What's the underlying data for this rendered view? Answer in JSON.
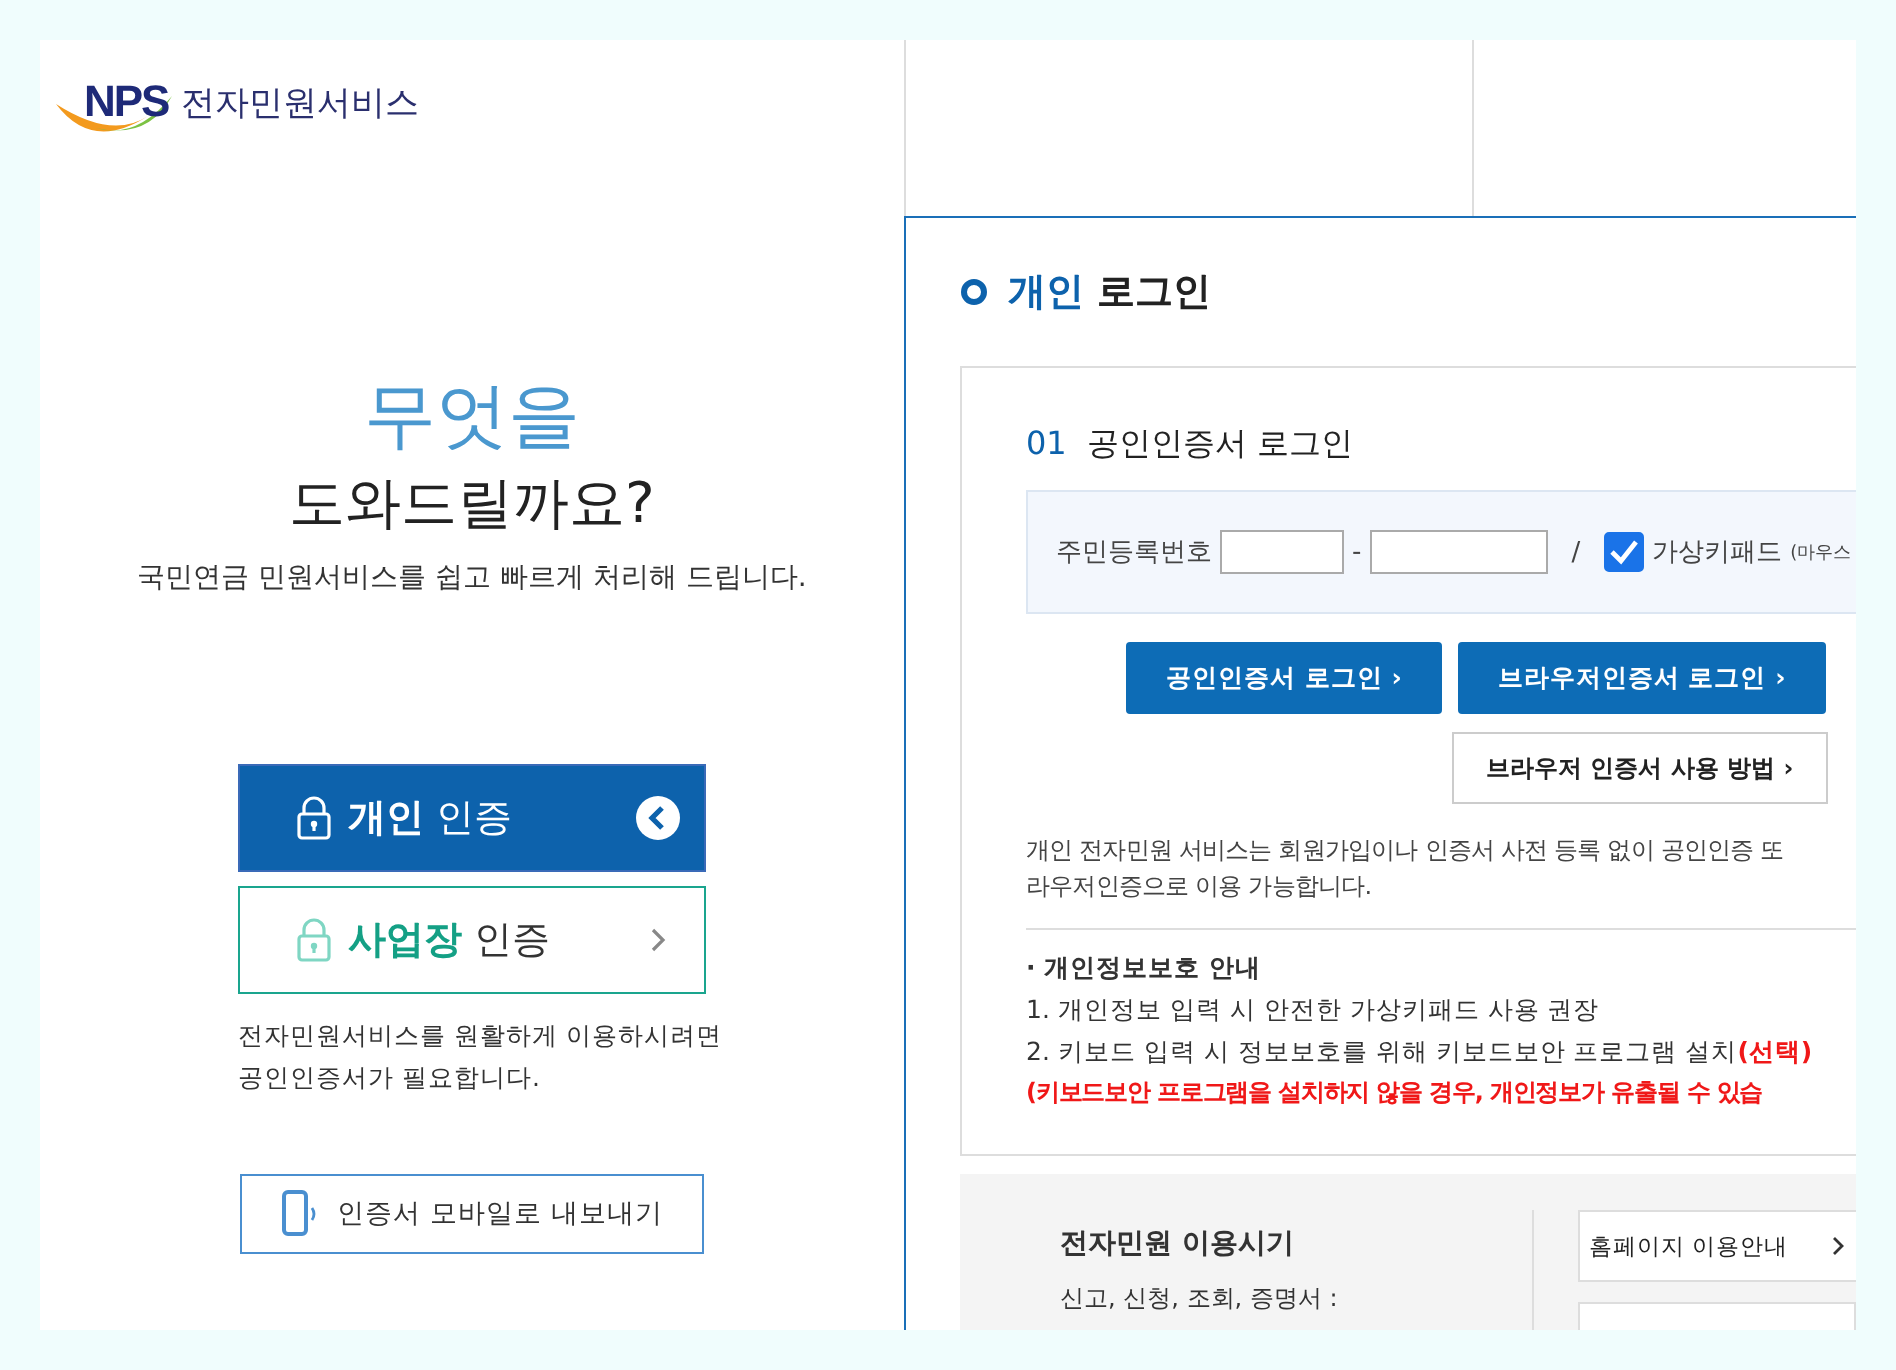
{
  "logo": {
    "mark": "NPS",
    "service": "전자민원서비스"
  },
  "hero": {
    "title": "무엇을",
    "subtitle": "도와드릴까요?",
    "description": "국민연금 민원서비스를 쉽고 빠르게 처리해 드립니다."
  },
  "auth_options": [
    {
      "label": "**개인** 인증",
      "kind": "personal",
      "selected": true
    },
    {
      "label": "**사업장** 인증",
      "kind": "business",
      "selected": false
    }
  ],
  "auth_note": [
    "전자민원서비스를 원활하게 이용하시려면",
    "공인인증서가 필요합니다."
  ],
  "mobile_export": "인증서 모바일로 내보내기",
  "login": {
    "title_highlight": "개인",
    "title_rest": "로그인",
    "section_number": "01",
    "section_title": "공인인증서 로그인",
    "id_label": "주민등록번호",
    "separator": "-",
    "slash": "/",
    "keypad": {
      "label": "가상키패드",
      "note": "(마우스",
      "checked": true
    },
    "buttons": [
      "공인인증서 로그인 ›",
      "브라우저인증서 로그인 ›"
    ],
    "help_button": "브라우저 인증서 사용 방법 ›",
    "description": [
      "개인 전자민원 서비스는 회원가입이나 인증서 사전 등록 없이 공인인증 또",
      "라우저인증으로 이용 가능합니다."
    ],
    "privacy_title": "· 개인정보보호 안내",
    "privacy_items": [
      {
        "text": "1. 개인정보 입력 시 안전한 가상키패드 사용 권장"
      },
      {
        "text": "2. 키보드 입력 시 정보보호를 위해 키보드보안 프로그램 설치",
        "note": "(선택)"
      }
    ],
    "warning": "(키보드보안 프로그램을 설치하지 않을 경우, 개인정보가 유출될 수 있습"
  },
  "hours": {
    "title": "전자민원 이용시기",
    "text": "신고, 신청, 조회, 증명서 :"
  },
  "guide_button": "홈페이지 이용안내"
}
